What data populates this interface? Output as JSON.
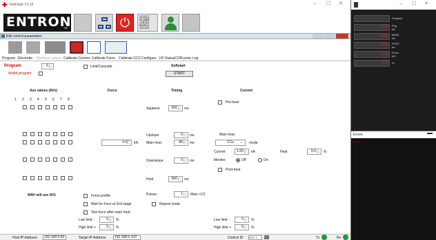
{
  "window": {
    "title": "NetFlash V1.16",
    "controls": [
      "–",
      "☐",
      "✕"
    ]
  },
  "logo": "ENTRON",
  "logo_tm": "TM",
  "toolbar_icons": [
    "network-icon",
    "stop-power-icon",
    "data-stream-icon",
    "user-icon",
    "keypad-icon"
  ],
  "panel": {
    "title": "Edit control parameters",
    "buttons": [
      "–",
      "☐",
      "✕"
    ]
  },
  "panel_icons": [
    "open-icon",
    "folder-icon",
    "device-icon",
    "save-icon",
    "copy-icon",
    "transfer-icon"
  ],
  "tabs": [
    "Program",
    "Electrode",
    "Realtime values",
    "Calibrate Current",
    "Calibrate Force",
    "Calibrate CCC",
    "Configure",
    "I/O Status",
    "COM ports",
    "Log"
  ],
  "program": {
    "label": "Program",
    "value": "0",
    "limit_label": "Limit/Cascade",
    "inhibit_label": "Inhibit program",
    "softstart_label": "Softstart",
    "start_button": "START"
  },
  "headers": {
    "aux": "Aux valves (AVx)",
    "force": "Force",
    "timing": "Timing",
    "current": "Current"
  },
  "valve_numbers": [
    "1",
    "2",
    "3",
    "4",
    "5",
    "6",
    "7",
    "8"
  ],
  "timing": {
    "squeeze_label": "Squeeze",
    "squeeze": "500",
    "upslope_label": "Upslope",
    "upslope": "0",
    "mainheat_label": "Main heat",
    "mainheat": "80",
    "downslope_label": "Downslope",
    "downslope": "0",
    "hold_label": "Hold",
    "hold": "500",
    "unit": "ms"
  },
  "force_value": "0.00",
  "force_unit": "kN",
  "current": {
    "preheat_label": "Pre-heat",
    "mainheat_label": "Main heat",
    "mode_value": "CCu",
    "mode_label": "mode",
    "current_label": "Current",
    "current_value": "1.00",
    "current_unit": "kA",
    "heat_label": "Heat",
    "heat_value": "0.0",
    "heat_unit": "%",
    "monitor_label": "Monitor",
    "off_label": "Off",
    "on_label": "On",
    "postheat_label": "Post-heat"
  },
  "bottom": {
    "wav_label": "WAV will use AV1",
    "force_profile": "Force profile",
    "wait_force": "Wait for force at 2nd stage",
    "test_force": "Test force after main heat",
    "pulses_label": "Pulses",
    "pulses_value": "1",
    "pulses_note": "Main <C2",
    "repeat_label": "Repeat mode",
    "low_limit": "Low limit -",
    "high_limit": "High limit +",
    "limit_value": "5",
    "pct": "%"
  },
  "status": {
    "host": "Host IP Address",
    "host_val": "192.168.0.65",
    "target": "Target IP Address",
    "target_val": "192.168.0.103",
    "control": "Control ID",
    "control_val": "CNT 1",
    "tx": "Tx",
    "rx": "Rx"
  },
  "right": {
    "labels": [
      [
        "Program"
      ],
      [
        "Peg",
        "kA"
      ],
      [
        "MAIN",
        "kA"
      ],
      [
        "POST",
        "kA"
      ],
      [
        "Force",
        "kN"
      ],
      [
        "%"
      ]
    ],
    "values": [
      "",
      "0.00",
      "0.00",
      "0.00",
      "0.00",
      "0.0"
    ],
    "errors_title": "Errors",
    "errors_sub": "Errors"
  }
}
